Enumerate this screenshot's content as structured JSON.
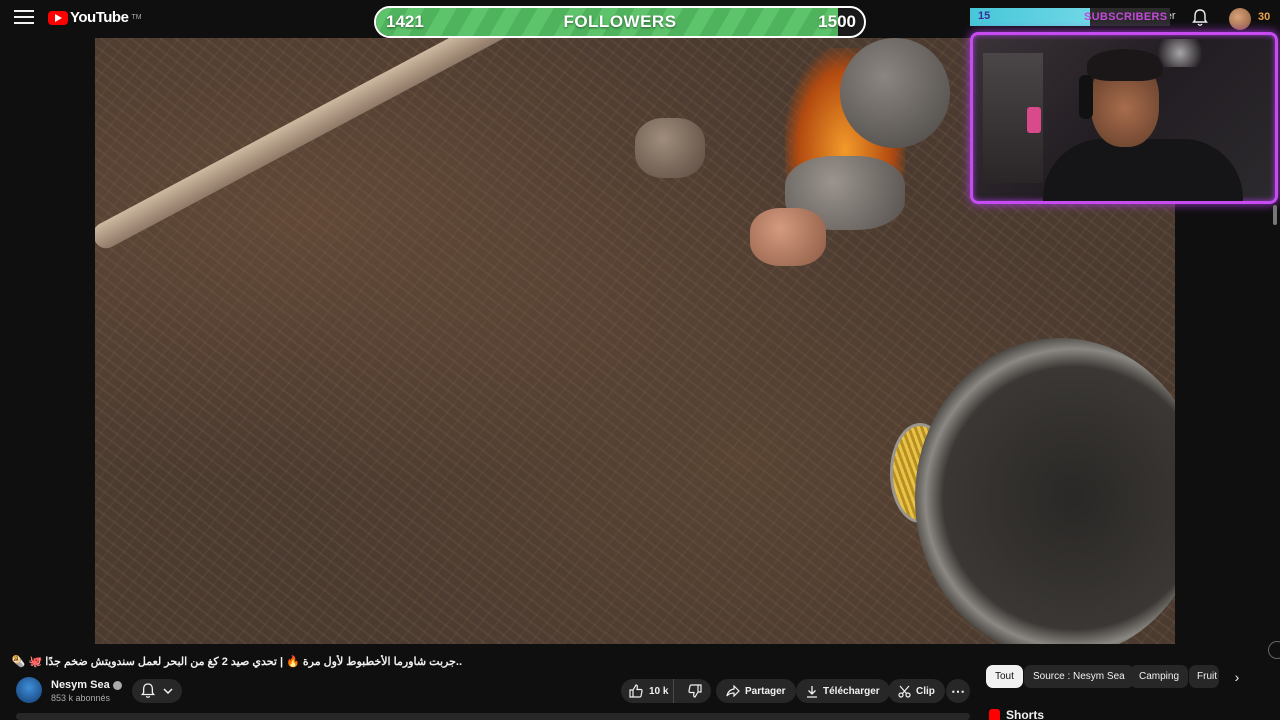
{
  "header": {
    "brand": "YouTube",
    "brand_sup": "TM",
    "create_label": "Créer",
    "icons": [
      "menu-icon",
      "youtube-logo-icon",
      "bell-icon",
      "avatar"
    ]
  },
  "overlays": {
    "followers": {
      "current": "1421",
      "label": "FOLLOWERS",
      "goal": "1500",
      "progress": 0.9473,
      "color": "#5ec46b"
    },
    "subscribers": {
      "count": "15",
      "label": "SUBSCRIBERS",
      "color": "#46c7d8"
    },
    "avatar_count": "30",
    "webcam_border_color": "#c64cf2"
  },
  "video": {
    "title": "..جربت شاورما الأخطبوط لأول مرة 🔥 | تحدي صيد 2 كغ من البحر لعمل سندويتش ضخم جدًا 🐙 🌯"
  },
  "channel": {
    "name": "Nesym Sea",
    "subscribers": "853 k abonnés"
  },
  "actions": {
    "likes": "10 k",
    "share": "Partager",
    "download": "Télécharger",
    "clip": "Clip",
    "more": "⋯"
  },
  "chips": [
    "Tout",
    "Source : Nesym Sea",
    "Camping",
    "Fruit"
  ],
  "shorts_label": "Shorts"
}
